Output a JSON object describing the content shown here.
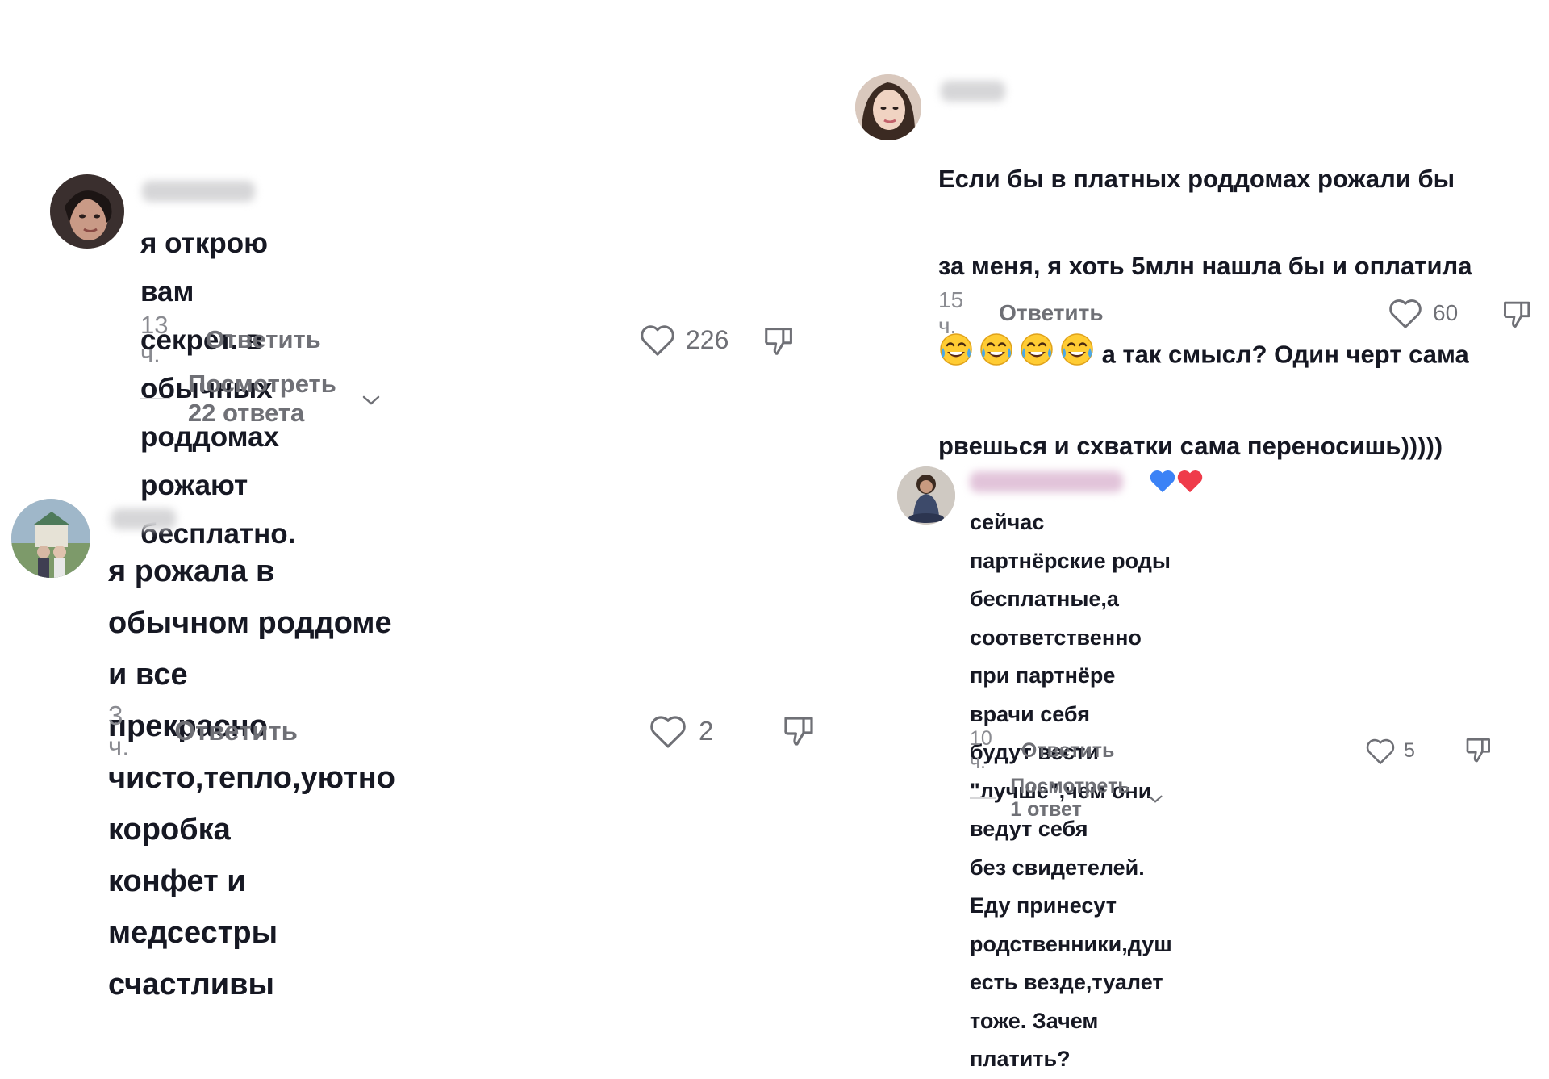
{
  "comments": [
    {
      "text": "я открою вам секрет. в обычных\nроддомах рожают бесплатно.",
      "time": "13 ч.",
      "reply_label": "Ответить",
      "likes": "226",
      "view_replies": "Посмотреть 22 ответа"
    },
    {
      "text": "я рожала в обычном роддоме и все\nпрекрасно чисто,тепло,уютно коробка\nконфет и медсестры счастливы",
      "time": "3 ч.",
      "reply_label": "Ответить",
      "likes": "2"
    },
    {
      "text_line1": "Если бы в платных роддомах рожали бы",
      "text_line2": "за меня, я хоть 5млн нашла бы и оплатила",
      "text_line3": " а так смысл? Один черт сама",
      "text_line4": "рвешься и схватки сама переносишь)))))",
      "time": "15 ч.",
      "reply_label": "Ответить",
      "likes": "60"
    },
    {
      "text": "сейчас партнёрские роды бесплатные,а\nсоответственно при партнёре врачи себя\nбудут вести \"лучше\",чем они ведут себя\nбез свидетелей. Еду принесут\nродственники,душ есть везде,туалет\nтоже. Зачем платить?",
      "time": "10 ч.",
      "reply_label": "Ответить",
      "likes": "5",
      "view_replies": "Посмотреть 1 ответ"
    }
  ],
  "icons": {
    "like": "heart-icon",
    "dislike": "thumbs-down-icon",
    "expand": "chevron-down-icon",
    "laugh": "tears-of-joy-emoji"
  },
  "colors": {
    "text": "#161823",
    "muted": "#8a8b91",
    "action": "#6f7076"
  }
}
